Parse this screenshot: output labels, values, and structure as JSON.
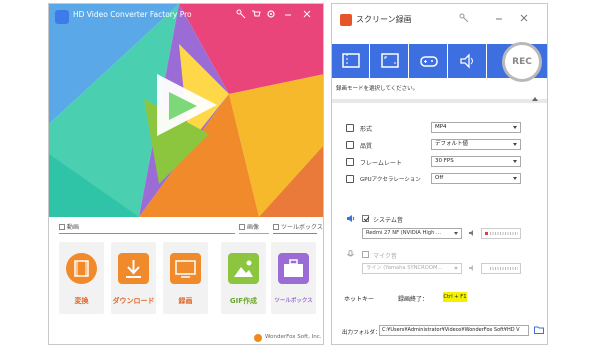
{
  "converter": {
    "title": "HD Video Converter Factory Pro",
    "accent": "#e2682a",
    "sections": {
      "video": "動画",
      "image": "画像",
      "toolbox": "ツールボックス"
    },
    "tools": [
      {
        "label": "変換",
        "icon": "film-icon",
        "color": "#f08a2a"
      },
      {
        "label": "ダウンロード",
        "icon": "download-icon",
        "color": "#f08a2a"
      },
      {
        "label": "録画",
        "icon": "screen-record-icon",
        "color": "#f08a2a"
      },
      {
        "label": "GIF作成",
        "icon": "image-icon",
        "color": "#8cc63f"
      },
      {
        "label": "ツールボックス",
        "icon": "toolbox-icon",
        "color": "#9b6cd6"
      }
    ],
    "footer": "WonderFox Soft, Inc."
  },
  "recorder": {
    "title": "スクリーン録画",
    "rec_label": "REC",
    "mode_hint": "録画モードを選択してください。",
    "accent": "#3d6fe0",
    "settings": [
      {
        "label": "形式",
        "value": "MP4",
        "icon": "format-icon"
      },
      {
        "label": "品質",
        "value": "デフォルト値",
        "icon": "quality-icon"
      },
      {
        "label": "フレームレート",
        "value": "30 FPS",
        "icon": "framerate-icon"
      },
      {
        "label": "GPUアクセラレーション",
        "value": "Off",
        "icon": "gpu-icon"
      }
    ],
    "audio": {
      "system_label": "システム音",
      "system_device": "Redmi 27 NF (NVIDIA High ...",
      "mic_label": "マイク音",
      "mic_device": "ライン (Yamaha SYNCROOM..."
    },
    "hotkey": {
      "label": "ホットキー",
      "desc": "録画終了：",
      "value": "Ctrl + F1"
    },
    "output": {
      "label": "出力フォルダ：",
      "path": "C:¥Users¥Administrator¥Videos¥WonderFox Soft¥HD V"
    }
  }
}
